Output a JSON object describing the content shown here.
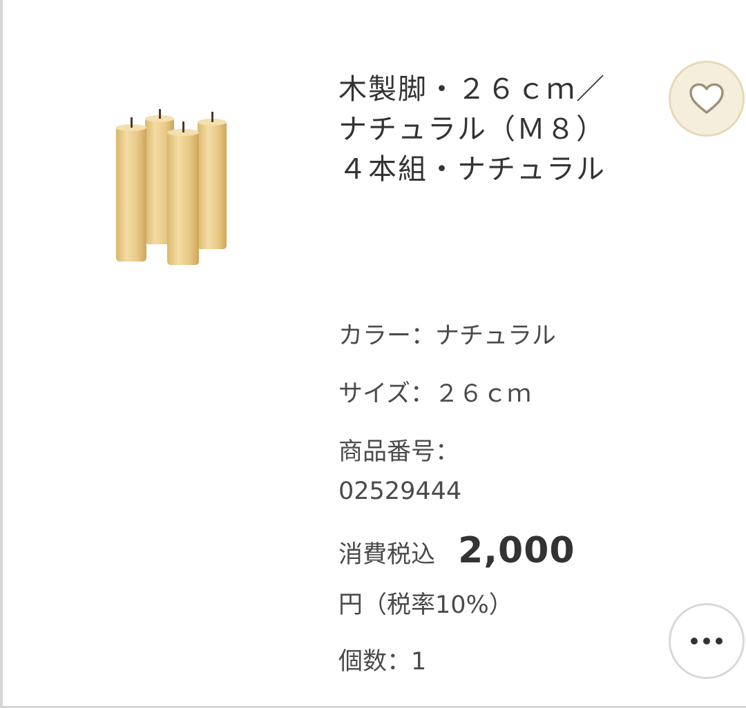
{
  "product": {
    "title": "木製脚・２６ｃｍ／ナチュラル（Ｍ８）　４本組・ナチュラル",
    "image_alt": "wooden-legs-photo",
    "color_line": "カラー：ナチュラル",
    "size_line": "サイズ：２６ｃｍ",
    "code_label": "商品番号：",
    "code_value": "02529444",
    "price_label": "消費税込",
    "price_value": "2,000",
    "price_unit": "円（税率10%）",
    "quantity_line": "個数：1"
  },
  "actions": {
    "favorite_icon": "heart-icon",
    "more_icon": "more-horizontal-icon"
  },
  "colors": {
    "favorite_bg": "#f5eedd",
    "favorite_border": "#e7d9b5",
    "wood": "#e9cf95"
  }
}
